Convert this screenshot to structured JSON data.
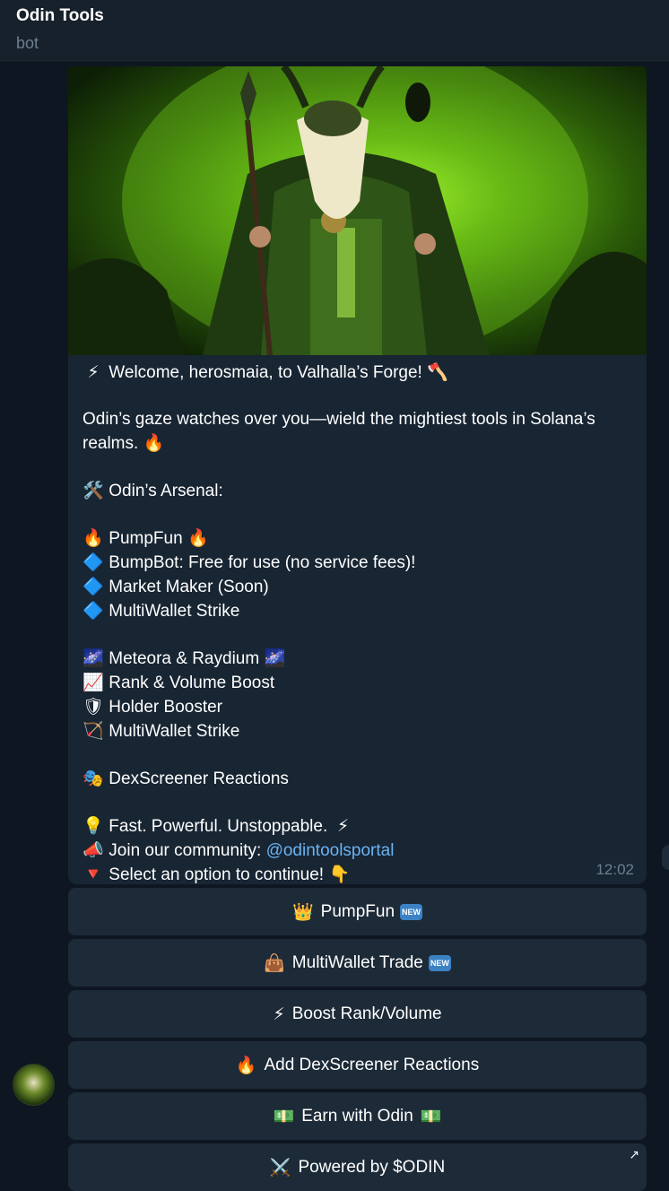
{
  "header": {
    "title": "Odin Tools",
    "subtitle": "bot"
  },
  "message": {
    "lines": {
      "welcome_icon": "⚡",
      "welcome": "Welcome, herosmaia, to Valhalla’s Forge!",
      "welcome_icon2": "🪓",
      "intro": "Odin’s gaze watches over you—wield the mightiest tools in Solana’s realms.",
      "intro_icon": "🔥",
      "arsenal_icon": "🛠️",
      "arsenal": "Odin’s Arsenal:",
      "pumpfun_icon": "🔥",
      "pumpfun": "PumpFun",
      "pumpfun_icon2": "🔥",
      "bumpbot_icon": "🔷",
      "bumpbot_title": "BumpBot",
      "bumpbot_desc": ": Free for use (no service fees)!",
      "marketmaker_icon": "🔷",
      "marketmaker": "Market Maker (Soon)",
      "multiwallet1_icon": "🔷",
      "multiwallet1": "MultiWallet Strike",
      "meteora_icon": "🌌",
      "meteora": "Meteora & Raydium",
      "meteora_icon2": "🌌",
      "rank_icon": "📈",
      "rank": "Rank & Volume Boost",
      "holder_icon": "🛡",
      "holder": "Holder Booster",
      "multiwallet2_icon": "🏹",
      "multiwallet2": "MultiWallet Strike",
      "dex_icon": "🎭",
      "dex": "DexScreener Reactions",
      "fast_icon": "💡",
      "fast": "Fast. Powerful. Unstoppable.",
      "fast_icon2": "⚡",
      "join_icon": "📣",
      "join": "Join our community:",
      "join_link": "@odintoolsportal",
      "select_icon": "🔻",
      "select": "Select an option to continue!",
      "select_icon2": "👇"
    },
    "time": "12:02"
  },
  "buttons": [
    {
      "icon": "👑",
      "label": "PumpFun",
      "badge": "NEW"
    },
    {
      "icon": "👜",
      "label": "MultiWallet Trade",
      "badge": "NEW"
    },
    {
      "icon": "⚡",
      "label": "Boost Rank/Volume"
    },
    {
      "icon": "🔥",
      "label": "Add DexScreener Reactions"
    },
    {
      "icon": "💵",
      "label": "Earn with Odin",
      "icon2": "💵"
    },
    {
      "icon": "⚔️",
      "label": "Powered by $ODIN",
      "arrow": "↗"
    }
  ],
  "colors": {
    "background": "#0e1621",
    "bubble": "#182533",
    "button": "#1d2a38",
    "link": "#6ab3f3",
    "muted": "#6d7f8f"
  }
}
